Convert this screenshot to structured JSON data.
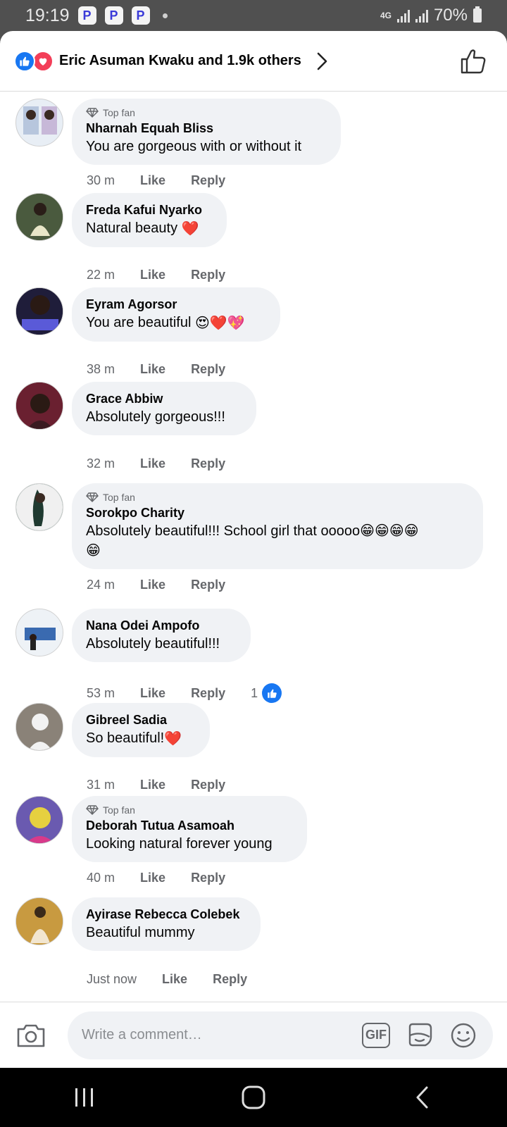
{
  "status_bar": {
    "time": "19:19",
    "app_badge": "P",
    "network": "4G",
    "battery": "70%"
  },
  "header": {
    "reactors": "Eric Asuman Kwaku and 1.9k others"
  },
  "comments": [
    {
      "badge": "Top fan",
      "author": "Nharnah Equah Bliss",
      "text": "You are gorgeous with or without it",
      "time": "30 m",
      "like": "Like",
      "reply": "Reply",
      "avatar_color": "#c8d4e6"
    },
    {
      "badge": "",
      "author": "Freda Kafui Nyarko",
      "text": "Natural beauty",
      "emoji": "❤️",
      "time": "22 m",
      "like": "Like",
      "reply": "Reply",
      "avatar_color": "#5b6b4a"
    },
    {
      "badge": "",
      "author": "Eyram Agorsor",
      "text": "You are beautiful",
      "emoji": "😍❤️💖",
      "time": "38 m",
      "like": "Like",
      "reply": "Reply",
      "avatar_color": "#1f1d3a"
    },
    {
      "badge": "",
      "author": "Grace Abbiw",
      "text": "Absolutely gorgeous!!!",
      "time": "32 m",
      "like": "Like",
      "reply": "Reply",
      "avatar_color": "#7a2a3a"
    },
    {
      "badge": "Top fan",
      "author": "Sorokpo Charity",
      "text": "Absolutely beautiful!!! School girl that ooooo😁😁😁😁",
      "text2": "😁",
      "time": "24 m",
      "like": "Like",
      "reply": "Reply",
      "avatar_color": "#2f6a5a"
    },
    {
      "badge": "",
      "author": "Nana Odei Ampofo",
      "text": "Absolutely beautiful!!!",
      "time": "53 m",
      "like": "Like",
      "reply": "Reply",
      "reaction_count": "1",
      "avatar_color": "#dfe5ec"
    },
    {
      "badge": "",
      "author": "Gibreel Sadia",
      "text": "So beautiful!",
      "emoji": "❤️",
      "time": "31 m",
      "like": "Like",
      "reply": "Reply",
      "avatar_color": "#8a8278"
    },
    {
      "badge": "Top fan",
      "author": "Deborah Tutua Asamoah",
      "text": "Looking natural forever young",
      "time": "40 m",
      "like": "Like",
      "reply": "Reply",
      "avatar_color": "#6a5ab0"
    },
    {
      "badge": "",
      "author": "Ayirase Rebecca Colebek",
      "text": "Beautiful mummy",
      "time": "Just now",
      "like": "Like",
      "reply": "Reply",
      "avatar_color": "#c89a40"
    }
  ],
  "composer": {
    "placeholder": "Write a comment…",
    "gif_label": "GIF"
  }
}
